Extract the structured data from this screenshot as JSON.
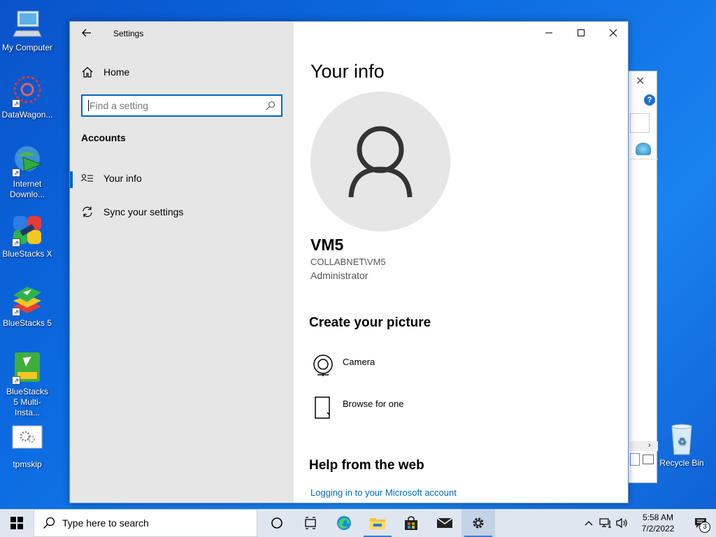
{
  "desktop": {
    "icons": [
      {
        "label": "My Computer"
      },
      {
        "label": "DataWagon..."
      },
      {
        "label": "Internet Downlo..."
      },
      {
        "label": "BlueStacks X"
      },
      {
        "label": "BlueStacks 5"
      },
      {
        "label": "BlueStacks 5 Multi-Insta..."
      },
      {
        "label": "tpmskip"
      }
    ],
    "recycle_bin": {
      "label": "Recycle Bin"
    }
  },
  "settings": {
    "window_title": "Settings",
    "nav": {
      "home_label": "Home",
      "search_placeholder": "Find a setting",
      "section": "Accounts",
      "items": [
        {
          "label": "Your info",
          "icon": "person-list-icon",
          "active": true
        },
        {
          "label": "Sync your settings",
          "icon": "sync-icon",
          "active": false
        }
      ]
    },
    "main": {
      "title": "Your info",
      "user": {
        "name": "VM5",
        "domain": "COLLABNET\\VM5",
        "role": "Administrator"
      },
      "create_picture": {
        "heading": "Create your picture",
        "options": [
          {
            "label": "Camera",
            "icon": "camera-icon"
          },
          {
            "label": "Browse for one",
            "icon": "document-icon"
          }
        ]
      },
      "help": {
        "heading": "Help from the web",
        "link": "Logging in to your Microsoft account"
      }
    }
  },
  "taskbar": {
    "search_placeholder": "Type here to search",
    "apps": [
      {
        "name": "cortana-icon"
      },
      {
        "name": "task-view-icon"
      },
      {
        "name": "edge-icon"
      },
      {
        "name": "file-explorer-icon"
      },
      {
        "name": "store-icon"
      },
      {
        "name": "mail-icon"
      },
      {
        "name": "settings-icon"
      }
    ],
    "clock": {
      "time": "5:58 AM",
      "date": "7/2/2022"
    },
    "notifications_count": "3"
  },
  "colors": {
    "accent": "#0067c0",
    "nav_bg": "#e6e6e6",
    "taskbar_bg": "#dfe6ef"
  }
}
